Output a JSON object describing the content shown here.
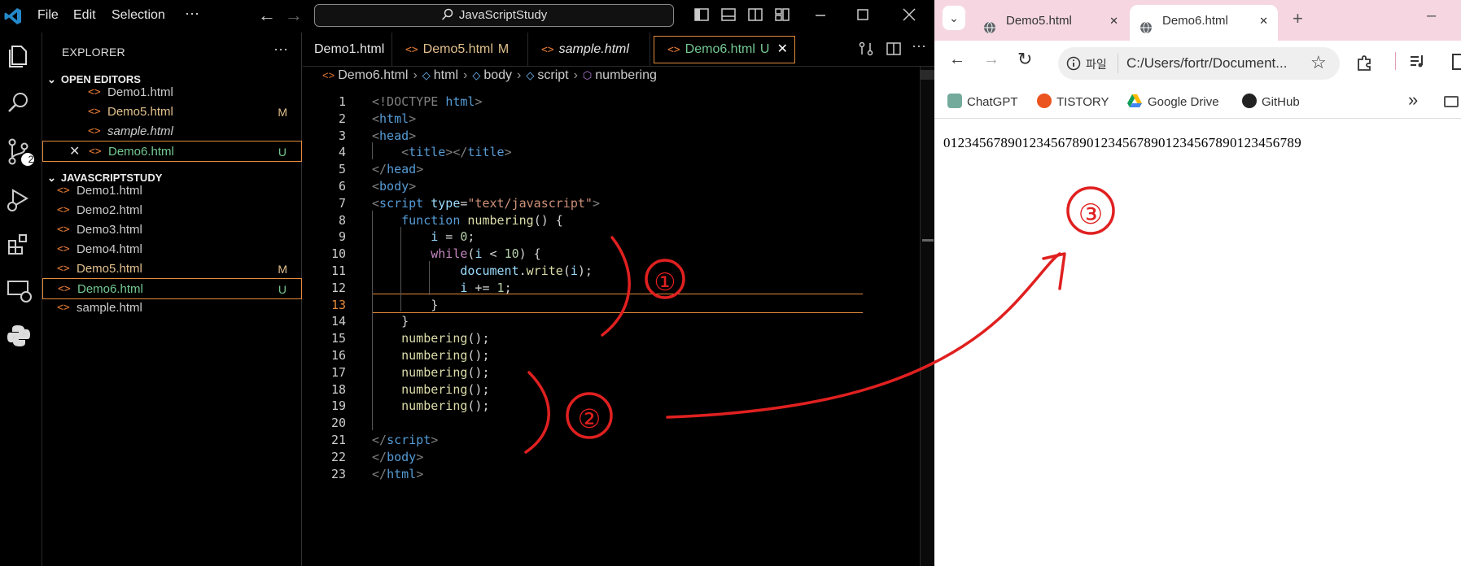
{
  "vscode": {
    "menu": [
      "File",
      "Edit",
      "Selection",
      "···"
    ],
    "command_center": "JavaScriptStudy",
    "explorer": {
      "title": "EXPLORER",
      "more": "···",
      "open_editors_label": "OPEN EDITORS",
      "open_editors": [
        {
          "name": "Demo1.html",
          "badge": "",
          "color": "#cccccc",
          "italic": false
        },
        {
          "name": "Demo5.html",
          "badge": "M",
          "color": "#e2c08d",
          "italic": false
        },
        {
          "name": "sample.html",
          "badge": "",
          "color": "#cccccc",
          "italic": true
        },
        {
          "name": "Demo6.html",
          "badge": "U",
          "color": "#73c991",
          "italic": false
        }
      ],
      "workspace_label": "JAVASCRIPTSTUDY",
      "files": [
        {
          "name": "Demo1.html",
          "badge": "",
          "color": "#cccccc"
        },
        {
          "name": "Demo2.html",
          "badge": "",
          "color": "#cccccc"
        },
        {
          "name": "Demo3.html",
          "badge": "",
          "color": "#cccccc"
        },
        {
          "name": "Demo4.html",
          "badge": "",
          "color": "#cccccc"
        },
        {
          "name": "Demo5.html",
          "badge": "M",
          "color": "#e2c08d"
        },
        {
          "name": "Demo6.html",
          "badge": "U",
          "color": "#73c991"
        },
        {
          "name": "sample.html",
          "badge": "",
          "color": "#cccccc"
        }
      ]
    },
    "source_control_count": "2",
    "tabs": [
      {
        "name": "Demo1.html",
        "badge": "",
        "color": "#e6e6e6",
        "italic": false
      },
      {
        "name": "Demo5.html",
        "badge": "M",
        "color": "#e2c08d",
        "italic": false
      },
      {
        "name": "sample.html",
        "badge": "",
        "color": "#e6e6e6",
        "italic": true
      },
      {
        "name": "Demo6.html",
        "badge": "U",
        "color": "#73c991",
        "italic": false
      }
    ],
    "tab_close": "✕",
    "breadcrumb": [
      "Demo6.html",
      "html",
      "body",
      "script",
      "numbering"
    ],
    "current_line": 13,
    "code": [
      [
        [
          "<!DOCTYPE ",
          "#808080"
        ],
        [
          "html",
          "#569cd6"
        ],
        [
          ">",
          "#808080"
        ]
      ],
      [
        [
          "<",
          "#808080"
        ],
        [
          "html",
          "#569cd6"
        ],
        [
          ">",
          "#808080"
        ]
      ],
      [
        [
          "<",
          "#808080"
        ],
        [
          "head",
          "#569cd6"
        ],
        [
          ">",
          "#808080"
        ]
      ],
      [
        [
          "    ",
          "#d4d4d4"
        ],
        [
          "<",
          "#808080"
        ],
        [
          "title",
          "#569cd6"
        ],
        [
          "></",
          "#808080"
        ],
        [
          "title",
          "#569cd6"
        ],
        [
          ">",
          "#808080"
        ]
      ],
      [
        [
          "</",
          "#808080"
        ],
        [
          "head",
          "#569cd6"
        ],
        [
          ">",
          "#808080"
        ]
      ],
      [
        [
          "<",
          "#808080"
        ],
        [
          "body",
          "#569cd6"
        ],
        [
          ">",
          "#808080"
        ]
      ],
      [
        [
          "<",
          "#808080"
        ],
        [
          "script",
          "#569cd6"
        ],
        [
          " ",
          "#d4d4d4"
        ],
        [
          "type",
          "#9cdcfe"
        ],
        [
          "=",
          "#d4d4d4"
        ],
        [
          "\"text/javascript\"",
          "#ce9178"
        ],
        [
          ">",
          "#808080"
        ]
      ],
      [
        [
          "    ",
          "#d4d4d4"
        ],
        [
          "function",
          "#569cd6"
        ],
        [
          " ",
          "#d4d4d4"
        ],
        [
          "numbering",
          "#dcdcaa"
        ],
        [
          "() {",
          "#d4d4d4"
        ]
      ],
      [
        [
          "        ",
          "#d4d4d4"
        ],
        [
          "i",
          "#9cdcfe"
        ],
        [
          " = ",
          "#d4d4d4"
        ],
        [
          "0",
          "#b5cea8"
        ],
        [
          ";",
          "#d4d4d4"
        ]
      ],
      [
        [
          "        ",
          "#d4d4d4"
        ],
        [
          "while",
          "#c586c0"
        ],
        [
          "(",
          "#d4d4d4"
        ],
        [
          "i",
          "#9cdcfe"
        ],
        [
          " < ",
          "#d4d4d4"
        ],
        [
          "10",
          "#b5cea8"
        ],
        [
          ") {",
          "#d4d4d4"
        ]
      ],
      [
        [
          "            ",
          "#d4d4d4"
        ],
        [
          "document",
          "#9cdcfe"
        ],
        [
          ".",
          "#d4d4d4"
        ],
        [
          "write",
          "#dcdcaa"
        ],
        [
          "(",
          "#d4d4d4"
        ],
        [
          "i",
          "#9cdcfe"
        ],
        [
          ");",
          "#d4d4d4"
        ]
      ],
      [
        [
          "            ",
          "#d4d4d4"
        ],
        [
          "i",
          "#9cdcfe"
        ],
        [
          " += ",
          "#d4d4d4"
        ],
        [
          "1",
          "#b5cea8"
        ],
        [
          ";",
          "#d4d4d4"
        ]
      ],
      [
        [
          "        ",
          "#d4d4d4"
        ],
        [
          "}",
          "#d4d4d4"
        ]
      ],
      [
        [
          "    ",
          "#d4d4d4"
        ],
        [
          "}",
          "#d4d4d4"
        ]
      ],
      [
        [
          "    ",
          "#d4d4d4"
        ],
        [
          "numbering",
          "#dcdcaa"
        ],
        [
          "();",
          "#d4d4d4"
        ]
      ],
      [
        [
          "    ",
          "#d4d4d4"
        ],
        [
          "numbering",
          "#dcdcaa"
        ],
        [
          "();",
          "#d4d4d4"
        ]
      ],
      [
        [
          "    ",
          "#d4d4d4"
        ],
        [
          "numbering",
          "#dcdcaa"
        ],
        [
          "();",
          "#d4d4d4"
        ]
      ],
      [
        [
          "    ",
          "#d4d4d4"
        ],
        [
          "numbering",
          "#dcdcaa"
        ],
        [
          "();",
          "#d4d4d4"
        ]
      ],
      [
        [
          "    ",
          "#d4d4d4"
        ],
        [
          "numbering",
          "#dcdcaa"
        ],
        [
          "();",
          "#d4d4d4"
        ]
      ],
      [],
      [
        [
          "</",
          "#808080"
        ],
        [
          "script",
          "#569cd6"
        ],
        [
          ">",
          "#808080"
        ]
      ],
      [
        [
          "</",
          "#808080"
        ],
        [
          "body",
          "#569cd6"
        ],
        [
          ">",
          "#808080"
        ]
      ],
      [
        [
          "</",
          "#808080"
        ],
        [
          "html",
          "#569cd6"
        ],
        [
          ">",
          "#808080"
        ]
      ]
    ]
  },
  "browser": {
    "tabs": [
      {
        "title": "Demo5.html",
        "close": "✕"
      },
      {
        "title": "Demo6.html",
        "close": "✕"
      }
    ],
    "new_tab": "+",
    "omnibox_chip": "파일",
    "url": "C:/Users/fortr/Document...",
    "bookmarks": [
      "ChatGPT",
      "TISTORY",
      "Google Drive",
      "GitHub"
    ],
    "bookmarks_more": "»",
    "page_output": "01234567890123456789012345678901234567890123456789"
  },
  "annotations": {
    "labels": [
      "①",
      "②",
      "③"
    ],
    "color": "#e02020"
  }
}
